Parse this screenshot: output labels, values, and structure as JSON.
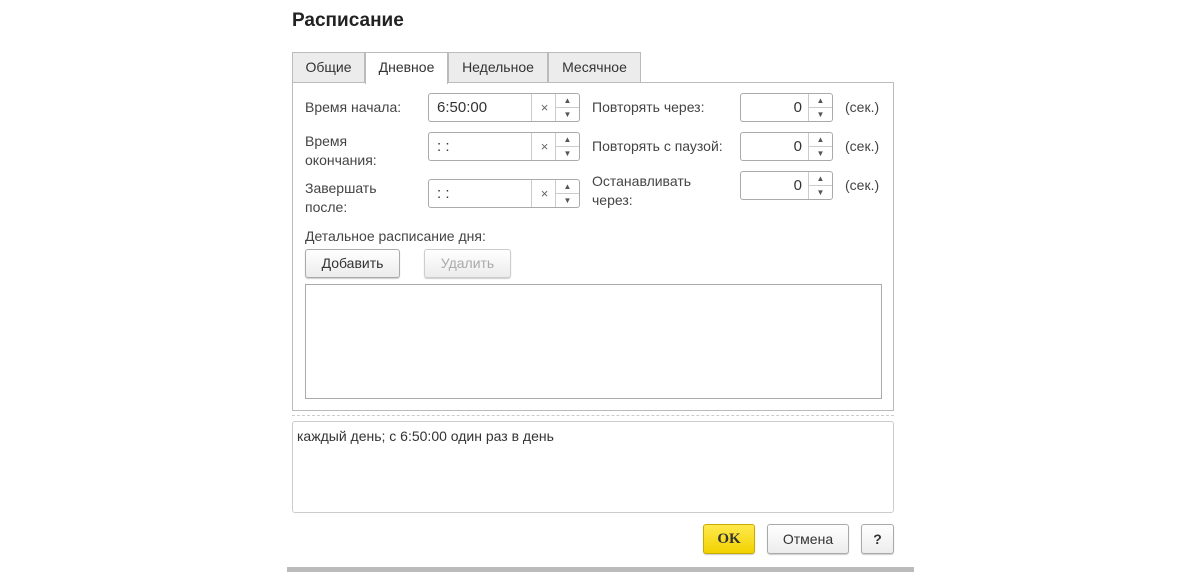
{
  "title": "Расписание",
  "tabs": [
    {
      "label": "Общие"
    },
    {
      "label": "Дневное",
      "active": true
    },
    {
      "label": "Недельное"
    },
    {
      "label": "Месячное"
    }
  ],
  "left_fields": [
    {
      "label": "Время начала:",
      "value": "6:50:00"
    },
    {
      "label": "Время окончания:",
      "value": " :  :"
    },
    {
      "label": "Завершать после:",
      "value": " :  :"
    }
  ],
  "right_fields": [
    {
      "label": "Повторять через:",
      "value": "0",
      "unit": "(сек.)"
    },
    {
      "label": "Повторять с паузой:",
      "value": "0",
      "unit": "(сек.)"
    },
    {
      "label": "Останавливать через:",
      "value": "0",
      "unit": "(сек.)"
    }
  ],
  "detail_label": "Детальное расписание дня:",
  "add_label": "Добавить",
  "delete_label": "Удалить",
  "summary": "каждый день; с 6:50:00 один раз в день",
  "ok_label": "OK",
  "cancel_label": "Отмена",
  "help_label": "?",
  "icons": {
    "clear": "×",
    "up": "▲",
    "down": "▼"
  },
  "colors": {
    "ok": "#f5d800"
  }
}
